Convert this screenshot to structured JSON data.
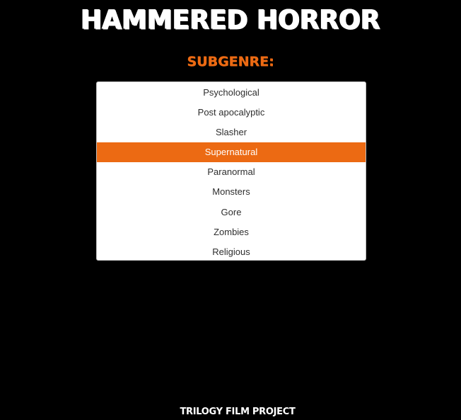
{
  "header": {
    "title": "HAMMERED HORROR",
    "subtitle": "SUBGENRE:"
  },
  "subgenre_select": {
    "options": [
      "Psychological",
      "Post apocalyptic",
      "Slasher",
      "Supernatural",
      "Paranormal",
      "Monsters",
      "Gore",
      "Zombies",
      "Religious"
    ],
    "selected": "Supernatural"
  },
  "footer": {
    "text": "TRILOGY FILM PROJECT"
  },
  "colors": {
    "background": "#000000",
    "accent": "#ec6a13",
    "title": "#ffffff"
  }
}
